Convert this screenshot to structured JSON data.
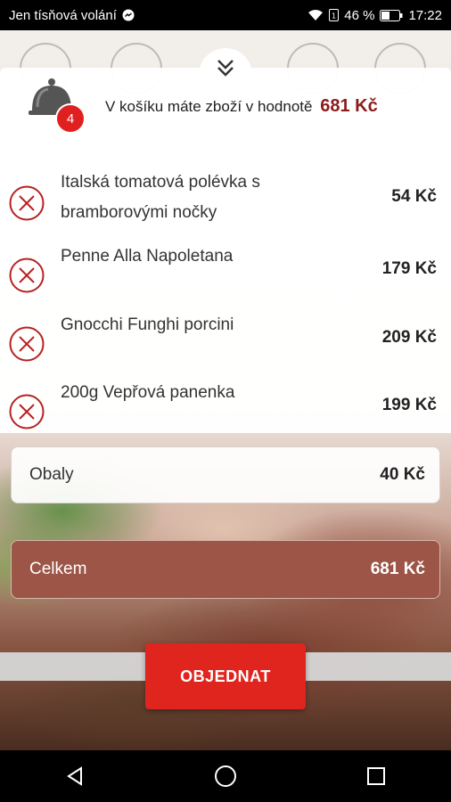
{
  "status_bar": {
    "carrier_text": "Jen tísňová volání",
    "battery": "46 %",
    "time": "17:22",
    "icons": [
      "messenger-icon",
      "wifi-icon",
      "sim-icon",
      "battery-icon"
    ]
  },
  "header": {
    "cart_count": "4",
    "cart_text": "V košíku máte zboží v hodnotě",
    "cart_total": "681 Kč"
  },
  "items": [
    {
      "name": "Italská tomatová polévka s bramborovými nočky",
      "price": "54 Kč"
    },
    {
      "name": "Penne Alla Napoletana",
      "price": "179 Kč"
    },
    {
      "name": "Gnocchi Funghi porcini",
      "price": "209 Kč"
    },
    {
      "name": "200g Vepřová panenka",
      "price": "199 Kč"
    }
  ],
  "packaging": {
    "label": "Obaly",
    "price": "40 Kč"
  },
  "total": {
    "label": "Celkem",
    "price": "681 Kč"
  },
  "order_button": {
    "label": "OBJEDNAT"
  },
  "colors": {
    "accent": "#e0241e",
    "total_bg": "#9c5546",
    "price_red": "#8a1c1c"
  }
}
